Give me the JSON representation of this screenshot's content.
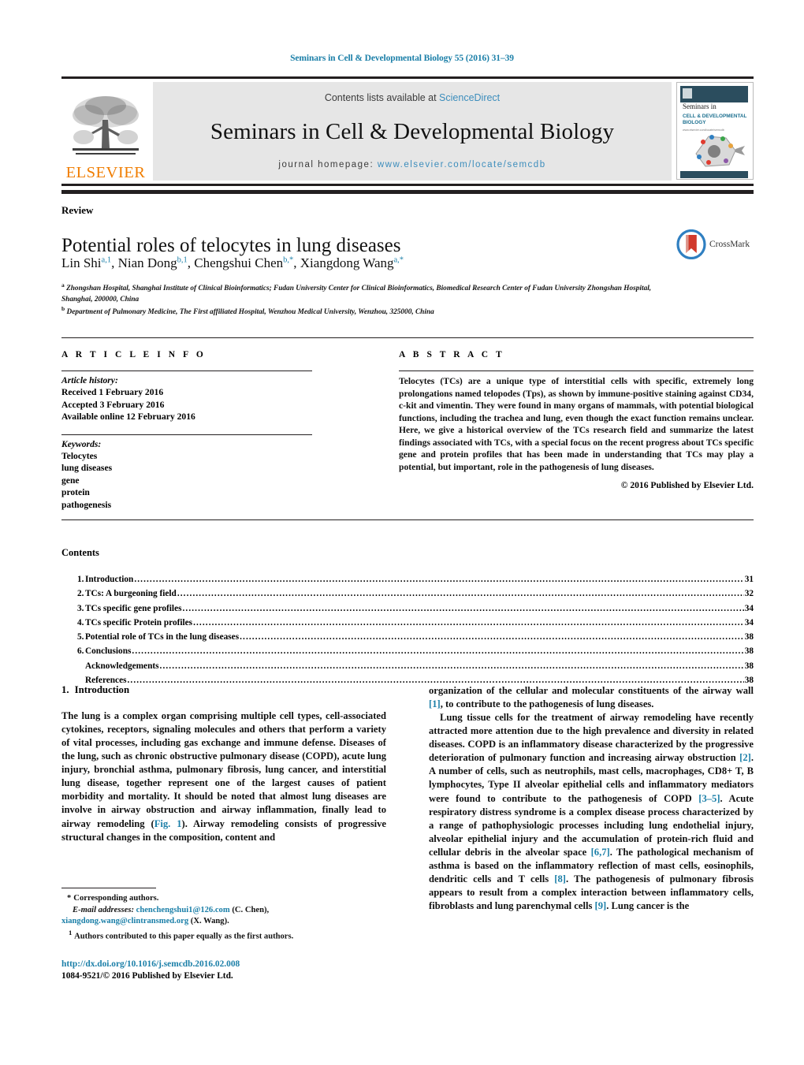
{
  "running_head": "Seminars in Cell & Developmental Biology 55 (2016) 31–39",
  "masthead": {
    "contents_prefix": "Contents lists available at ",
    "sciencedirect": "ScienceDirect",
    "journal_title": "Seminars in Cell & Developmental Biology",
    "homepage_prefix": "journal homepage: ",
    "homepage_url": "www.elsevier.com/locate/semcdb",
    "publisher": "ELSEVIER",
    "cover": {
      "line1": "Seminars in",
      "line2": "CELL & DEVELOPMENTAL",
      "line3": "BIOLOGY",
      "line4": "www.elsevier.com/locate/semcdb"
    },
    "accent_link_color": "#3c8dbc",
    "publisher_color": "#f07d00"
  },
  "article": {
    "doctype": "Review",
    "title": "Potential roles of telocytes in lung diseases",
    "authors_html": "Lin Shi<sup>a,1</sup>, Nian Dong<sup>b,1</sup>, Chengshui Chen<sup>b,*</sup>, Xiangdong Wang<sup>a,*</sup>",
    "affiliation_a": "Zhongshan Hospital, Shanghai Institute of Clinical Bioinformatics; Fudan University Center for Clinical Bioinformatics, Biomedical Research Center of Fudan University Zhongshan Hospital, Shanghai, 200000, China",
    "affiliation_b": "Department of Pulmonary Medicine, The First affiliated Hospital, Wenzhou Medical University, Wenzhou, 325000, China",
    "crossmark_label": "CrossMark"
  },
  "article_info": {
    "heading": "A R T I C L E   I N F O",
    "history_label": "Article history:",
    "history": [
      "Received 1 February 2016",
      "Accepted 3 February 2016",
      "Available online 12 February 2016"
    ],
    "keywords_label": "Keywords:",
    "keywords": [
      "Telocytes",
      "lung diseases",
      "gene",
      "protein",
      "pathogenesis"
    ]
  },
  "abstract": {
    "heading": "A B S T R A C T",
    "text": "Telocytes (TCs) are a unique type of interstitial cells with specific, extremely long prolongations named telopodes (Tps), as shown by immune-positive staining against CD34, c-kit and vimentin. They were found in many organs of mammals, with potential biological functions, including the trachea and lung, even though the exact function remains unclear. Here, we give a historical overview of the TCs research field and summarize the latest findings associated with TCs, with a special focus on the recent progress about TCs specific gene and protein profiles that has been made in understanding that TCs may play a potential, but important, role in the pathogenesis of lung diseases.",
    "copyright": "© 2016 Published by Elsevier Ltd."
  },
  "contents": {
    "heading": "Contents",
    "entries": [
      {
        "num": "1.",
        "label": "Introduction",
        "page": "31"
      },
      {
        "num": "2.",
        "label": "TCs: A burgeoning field",
        "page": "32"
      },
      {
        "num": "3.",
        "label": "TCs specific gene profiles",
        "page": "34"
      },
      {
        "num": "4.",
        "label": "TCs specific Protein profiles",
        "page": "34"
      },
      {
        "num": "5.",
        "label": "Potential role of TCs in the lung diseases",
        "page": "38"
      },
      {
        "num": "6.",
        "label": "Conclusions",
        "page": "38"
      },
      {
        "num": "",
        "label": "Acknowledgements",
        "page": "38"
      },
      {
        "num": "",
        "label": "References",
        "page": "38"
      }
    ]
  },
  "body": {
    "section_num": "1.",
    "section_title": "Introduction",
    "left_p1": "The lung is a complex organ comprising multiple cell types, cell-associated cytokines, receptors, signaling molecules and others that perform a variety of vital processes, including gas exchange and immune defense. Diseases of the lung, such as chronic obstructive pulmonary disease (COPD), acute lung injury, bronchial asthma, pulmonary fibrosis, lung cancer, and interstitial lung disease, together represent one of the largest causes of patient morbidity and mortality. It should be noted that almost lung diseases are involve in airway obstruction and airway inflammation, finally lead to airway remodeling (Fig. 1). Airway remodeling consists of progressive structural changes in the composition, content and",
    "left_p1_figref": "Fig. 1",
    "right_p1_a": "organization of the cellular and molecular constituents of the airway wall ",
    "right_p1_ref": "[1]",
    "right_p1_b": ", to contribute to the pathogenesis of lung diseases.",
    "right_p2": "Lung tissue cells for the treatment of airway remodeling have recently attracted more attention due to the high prevalence and diversity in related diseases. COPD is an inflammatory disease characterized by the progressive deterioration of pulmonary function and increasing airway obstruction [2]. A number of cells, such as neutrophils, mast cells, macrophages, CD8+ T, B lymphocytes, Type II alveolar epithelial cells and inflammatory mediators were found to contribute to the pathogenesis of COPD [3–5]. Acute respiratory distress syndrome is a complex disease process characterized by a range of pathophysiologic processes including lung endothelial injury, alveolar epithelial injury and the accumulation of protein-rich fluid and cellular debris in the alveolar space [6,7]. The pathological mechanism of asthma is based on the inflammatory reflection of mast cells, eosinophils, dendritic cells and T cells [8]. The pathogenesis of pulmonary fibrosis appears to result from a complex interaction between inflammatory cells, fibroblasts and lung parenchymal cells [9]. Lung cancer is the"
  },
  "footnotes": {
    "corresponding": "Corresponding authors.",
    "email_label": "E-mail addresses:",
    "email1": "chenchengshui1@126.com",
    "email1_owner": "(C. Chen),",
    "email2": "xiangdong.wang@clintransmed.org",
    "email2_owner": "(X. Wang).",
    "equal_contrib": "Authors contributed to this paper equally as the first authors.",
    "doi": "http://dx.doi.org/10.1016/j.semcdb.2016.02.008",
    "issn_line": "1084-9521/© 2016 Published by Elsevier Ltd."
  }
}
